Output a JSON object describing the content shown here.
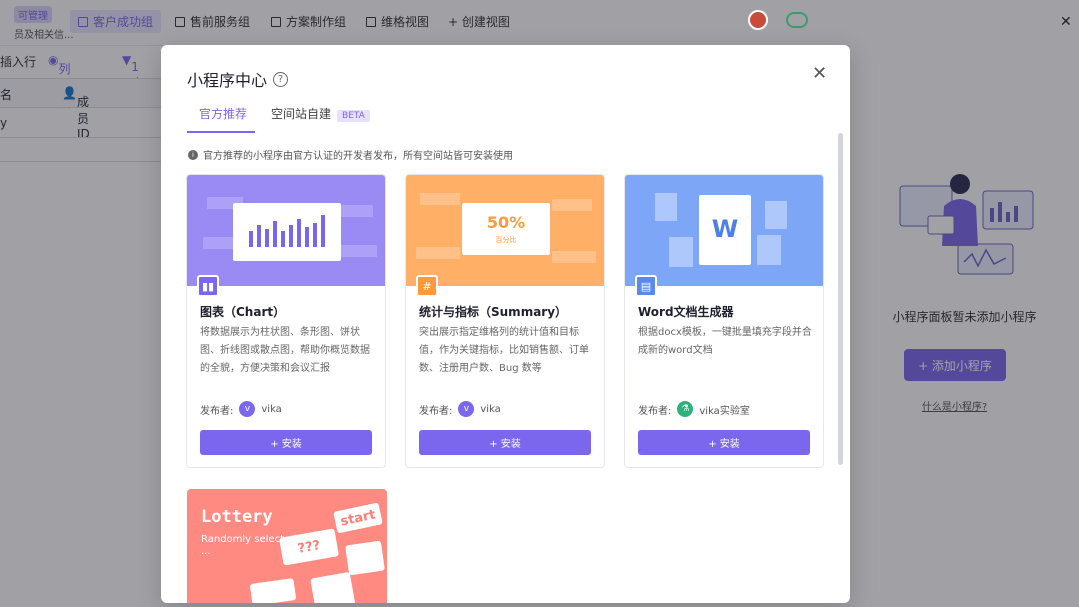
{
  "background": {
    "perm_badge": "可管理",
    "perm_sub": "员及相关信...",
    "tabs": [
      "客户成功组",
      "售前服务组",
      "方案制作组",
      "维格视图",
      "+ 创建视图"
    ],
    "toolbar": [
      "插入行",
      "列隐藏",
      "1 个"
    ],
    "grid_headers": [
      "名",
      "成员ID"
    ],
    "grid_row": "y"
  },
  "modal": {
    "title": "小程序中心",
    "tabs": {
      "official": "官方推荐",
      "space": "空间站自建",
      "beta": "BETA"
    },
    "notice": "官方推荐的小程序由官方认证的开发者发布，所有空间站皆可安装使用",
    "publisher_label": "发布者:",
    "install_label": "+ 安装",
    "cards": [
      {
        "name": "图表（Chart）",
        "desc": "将数据展示为柱状图、条形图、饼状图、折线图或散点图，帮助你概览数据的全貌，方便决策和会议汇报",
        "publisher": "vika",
        "banner_color": "#9a8af4",
        "icon": "bar-chart-icon"
      },
      {
        "name": "统计与指标（Summary）",
        "desc": "突出展示指定维格列的统计值和目标值，作为关键指标，比如销售额、订单数、注册用户数、Bug 数等",
        "publisher": "vika",
        "banner_color": "#ffb066",
        "banner_value": "50%",
        "banner_caption": "百分比",
        "icon": "hash-icon"
      },
      {
        "name": "Word文档生成器",
        "desc": "根据docx模板，一键批量填充字段并合成新的word文档",
        "publisher": "vika实验室",
        "banner_color": "#7ea6f7",
        "banner_letter": "W",
        "icon": "word-doc-icon"
      }
    ],
    "lottery": {
      "title": "Lottery",
      "subtitle": "Randomly selected data",
      "subtitle_tail": "...",
      "card_start": "start",
      "card_q": "???"
    }
  },
  "right_panel": {
    "empty_text": "小程序面板暂未添加小程序",
    "add_button": "+ 添加小程序",
    "help_link": "什么是小程序?"
  }
}
